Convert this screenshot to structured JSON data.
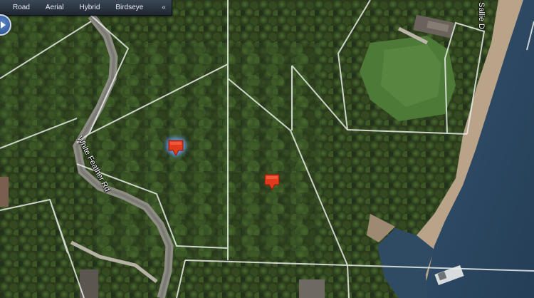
{
  "toolbar": {
    "options": [
      {
        "label": "Road"
      },
      {
        "label": "Aerial"
      },
      {
        "label": "Hybrid"
      },
      {
        "label": "Birdseye"
      }
    ],
    "collapse_glyph": "«"
  },
  "map": {
    "view": "aerial",
    "streets": [
      {
        "label": "White Feather Rd"
      },
      {
        "label": "Sallie D"
      }
    ],
    "pins": [
      {
        "name": "property-pin-selected",
        "selected": true
      },
      {
        "name": "property-pin",
        "selected": false
      }
    ],
    "colors": {
      "parcel_line": "#e9ede9",
      "pin": "#e03a1c",
      "pin_glow": "#6fa3ff",
      "water": "#2d4b66",
      "forest": "#2e3f1e",
      "clearing": "#4f7a3a"
    },
    "icons": [
      "compass-icon",
      "pushpin-icon",
      "collapse-icon"
    ]
  }
}
